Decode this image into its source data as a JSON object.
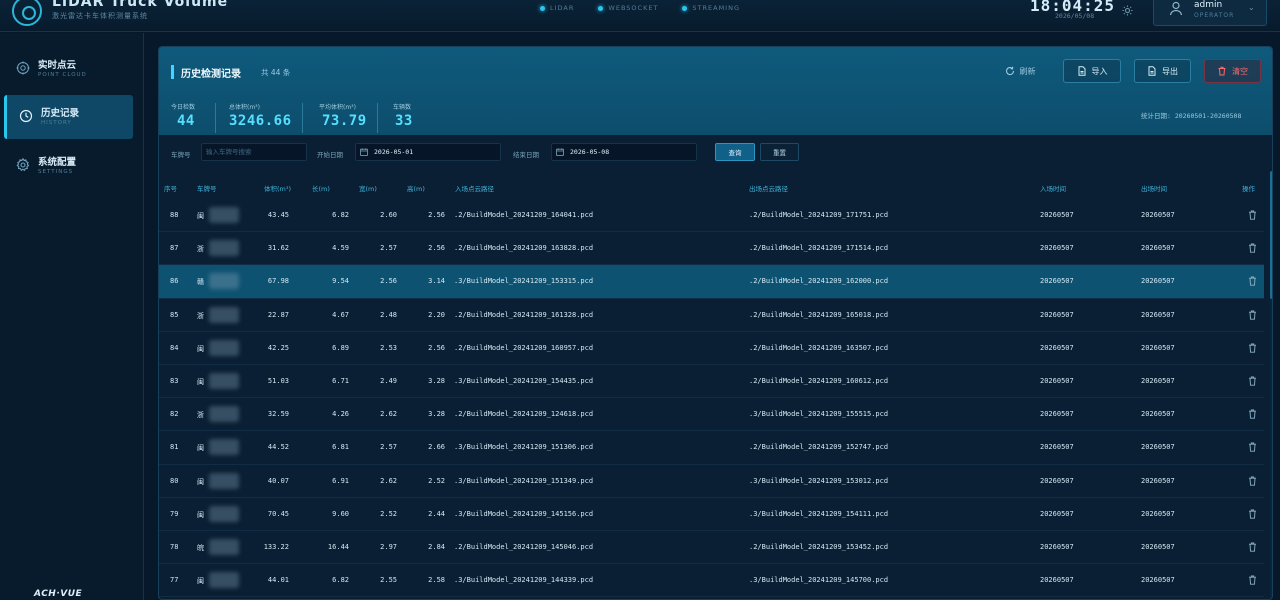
{
  "app": {
    "title": "LIDAR Truck Volume",
    "subtitle": "激光雷达卡车体积测量系统"
  },
  "status": [
    {
      "label": "LIDAR"
    },
    {
      "label": "WEBSOCKET"
    },
    {
      "label": "STREAMING"
    }
  ],
  "clock": {
    "time": "18:04:25",
    "date": "2026/05/08"
  },
  "user": {
    "name": "admin",
    "role": "OPERATOR"
  },
  "sidebar": {
    "items": [
      {
        "label": "实时点云",
        "sub": "POINT CLOUD"
      },
      {
        "label": "历史记录",
        "sub": "HISTORY"
      },
      {
        "label": "系统配置",
        "sub": "SETTINGS"
      }
    ],
    "brand": "ACH·VUE"
  },
  "panel": {
    "title": "历史检测记录",
    "count_text": "共 44 条",
    "buttons": {
      "refresh": "刷新",
      "import": "导入",
      "export": "导出",
      "clear": "清空"
    },
    "stats": [
      {
        "label": "今日检数",
        "value": "44"
      },
      {
        "label": "总体积(m³)",
        "value": "3246.66"
      },
      {
        "label": "平均体积(m³)",
        "value": "73.79"
      },
      {
        "label": "车辆数",
        "value": "33"
      }
    ],
    "stats_date": "统计日期: 20260501-20260508"
  },
  "filters": {
    "plate_label": "车牌号",
    "plate_placeholder": "输入车牌号搜索",
    "start_label": "开始日期",
    "start_value": "2026-05-01",
    "end_label": "结束日期",
    "end_value": "2026-05-08",
    "query": "查询",
    "reset": "重置"
  },
  "table": {
    "headers": [
      "序号",
      "车牌号",
      "体积(m³)",
      "长(m)",
      "宽(m)",
      "高(m)",
      "入场点云路径",
      "出场点云路径",
      "入场时间",
      "出场时间",
      "操作"
    ],
    "rows": [
      {
        "id": "88",
        "plate": "闽",
        "volume": "43.45",
        "length": "6.82",
        "width": "2.60",
        "height": "2.56",
        "in_path": ".2/BuildModel_20241209_164041.pcd",
        "out_path": ".2/BuildModel_20241209_171751.pcd",
        "in_time": "20260507",
        "out_time": "20260507"
      },
      {
        "id": "87",
        "plate": "浙",
        "volume": "31.62",
        "length": "4.59",
        "width": "2.57",
        "height": "2.56",
        "in_path": ".2/BuildModel_20241209_163828.pcd",
        "out_path": ".2/BuildModel_20241209_171514.pcd",
        "in_time": "20260507",
        "out_time": "20260507"
      },
      {
        "id": "86",
        "plate": "赣",
        "volume": "67.98",
        "length": "9.54",
        "width": "2.56",
        "height": "3.14",
        "in_path": ".3/BuildModel_20241209_153315.pcd",
        "out_path": ".2/BuildModel_20241209_162000.pcd",
        "in_time": "20260507",
        "out_time": "20260507"
      },
      {
        "id": "85",
        "plate": "浙",
        "volume": "22.87",
        "length": "4.67",
        "width": "2.48",
        "height": "2.20",
        "in_path": ".2/BuildModel_20241209_161328.pcd",
        "out_path": ".2/BuildModel_20241209_165018.pcd",
        "in_time": "20260507",
        "out_time": "20260507"
      },
      {
        "id": "84",
        "plate": "闽",
        "volume": "42.25",
        "length": "6.89",
        "width": "2.53",
        "height": "2.56",
        "in_path": ".2/BuildModel_20241209_160957.pcd",
        "out_path": ".2/BuildModel_20241209_163507.pcd",
        "in_time": "20260507",
        "out_time": "20260507"
      },
      {
        "id": "83",
        "plate": "闽",
        "volume": "51.03",
        "length": "6.71",
        "width": "2.49",
        "height": "3.28",
        "in_path": ".3/BuildModel_20241209_154435.pcd",
        "out_path": ".2/BuildModel_20241209_160612.pcd",
        "in_time": "20260507",
        "out_time": "20260507"
      },
      {
        "id": "82",
        "plate": "浙",
        "volume": "32.59",
        "length": "4.26",
        "width": "2.62",
        "height": "3.28",
        "in_path": ".2/BuildModel_20241209_124618.pcd",
        "out_path": ".3/BuildModel_20241209_155515.pcd",
        "in_time": "20260507",
        "out_time": "20260507"
      },
      {
        "id": "81",
        "plate": "闽",
        "volume": "44.52",
        "length": "6.81",
        "width": "2.57",
        "height": "2.66",
        "in_path": ".3/BuildModel_20241209_151306.pcd",
        "out_path": ".2/BuildModel_20241209_152747.pcd",
        "in_time": "20260507",
        "out_time": "20260507"
      },
      {
        "id": "80",
        "plate": "闽",
        "volume": "40.07",
        "length": "6.91",
        "width": "2.62",
        "height": "2.52",
        "in_path": ".3/BuildModel_20241209_151349.pcd",
        "out_path": ".3/BuildModel_20241209_153012.pcd",
        "in_time": "20260507",
        "out_time": "20260507"
      },
      {
        "id": "79",
        "plate": "闽",
        "volume": "70.45",
        "length": "9.60",
        "width": "2.52",
        "height": "2.44",
        "in_path": ".3/BuildModel_20241209_145156.pcd",
        "out_path": ".3/BuildModel_20241209_154111.pcd",
        "in_time": "20260507",
        "out_time": "20260507"
      },
      {
        "id": "78",
        "plate": "皖",
        "volume": "133.22",
        "length": "16.44",
        "width": "2.97",
        "height": "2.84",
        "in_path": ".2/BuildModel_20241209_145046.pcd",
        "out_path": ".2/BuildModel_20241209_153452.pcd",
        "in_time": "20260507",
        "out_time": "20260507"
      },
      {
        "id": "77",
        "plate": "闽",
        "volume": "44.01",
        "length": "6.82",
        "width": "2.55",
        "height": "2.58",
        "in_path": ".3/BuildModel_20241209_144339.pcd",
        "out_path": ".3/BuildModel_20241209_145700.pcd",
        "in_time": "20260507",
        "out_time": "20260507"
      }
    ]
  }
}
